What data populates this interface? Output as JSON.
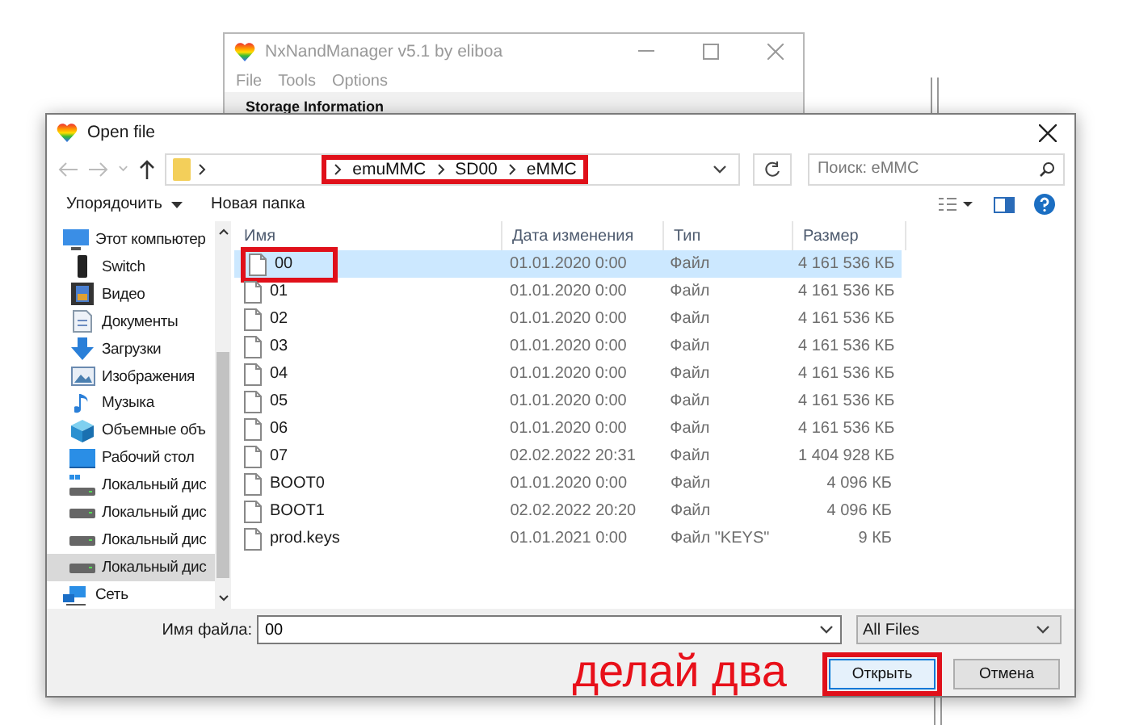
{
  "background_window": {
    "title": "NxNandManager v5.1 by eliboa",
    "menu": [
      "File",
      "Tools",
      "Options"
    ],
    "section_title": "Storage Information"
  },
  "dialog": {
    "title": "Open file",
    "address": {
      "crumbs": [
        "emuMMC",
        "SD00",
        "eMMC"
      ],
      "highlighted": true
    },
    "search": {
      "placeholder": "Поиск: eMMC"
    },
    "toolbar": {
      "organize": "Упорядочить",
      "new_folder": "Новая папка"
    },
    "nav": {
      "items": [
        {
          "label": "Этот компьютер",
          "kind": "computer",
          "selected": false,
          "child": false
        },
        {
          "label": "Switch",
          "kind": "device",
          "selected": false,
          "child": true
        },
        {
          "label": "Видео",
          "kind": "video",
          "selected": false,
          "child": true
        },
        {
          "label": "Документы",
          "kind": "documents",
          "selected": false,
          "child": true
        },
        {
          "label": "Загрузки",
          "kind": "downloads",
          "selected": false,
          "child": true
        },
        {
          "label": "Изображения",
          "kind": "pictures",
          "selected": false,
          "child": true
        },
        {
          "label": "Музыка",
          "kind": "music",
          "selected": false,
          "child": true
        },
        {
          "label": "Объемные объ",
          "kind": "objects",
          "selected": false,
          "child": true
        },
        {
          "label": "Рабочий стол",
          "kind": "desktop",
          "selected": false,
          "child": true
        },
        {
          "label": "Локальный дис",
          "kind": "system_disk",
          "selected": false,
          "child": true
        },
        {
          "label": "Локальный дис",
          "kind": "disk",
          "selected": false,
          "child": true
        },
        {
          "label": "Локальный дис",
          "kind": "disk",
          "selected": false,
          "child": true
        },
        {
          "label": "Локальный дис",
          "kind": "disk",
          "selected": true,
          "child": true
        }
      ],
      "network": "Сеть"
    },
    "table": {
      "columns": [
        "Имя",
        "Дата изменения",
        "Тип",
        "Размер"
      ],
      "rows": [
        {
          "name": "00",
          "date": "01.01.2020 0:00",
          "type": "Файл",
          "size": "4 161 536 КБ",
          "selected": true,
          "highlighted": true
        },
        {
          "name": "01",
          "date": "01.01.2020 0:00",
          "type": "Файл",
          "size": "4 161 536 КБ",
          "selected": false,
          "highlighted": false
        },
        {
          "name": "02",
          "date": "01.01.2020 0:00",
          "type": "Файл",
          "size": "4 161 536 КБ",
          "selected": false,
          "highlighted": false
        },
        {
          "name": "03",
          "date": "01.01.2020 0:00",
          "type": "Файл",
          "size": "4 161 536 КБ",
          "selected": false,
          "highlighted": false
        },
        {
          "name": "04",
          "date": "01.01.2020 0:00",
          "type": "Файл",
          "size": "4 161 536 КБ",
          "selected": false,
          "highlighted": false
        },
        {
          "name": "05",
          "date": "01.01.2020 0:00",
          "type": "Файл",
          "size": "4 161 536 КБ",
          "selected": false,
          "highlighted": false
        },
        {
          "name": "06",
          "date": "01.01.2020 0:00",
          "type": "Файл",
          "size": "4 161 536 КБ",
          "selected": false,
          "highlighted": false
        },
        {
          "name": "07",
          "date": "02.02.2022 20:31",
          "type": "Файл",
          "size": "1 404 928 КБ",
          "selected": false,
          "highlighted": false
        },
        {
          "name": "BOOT0",
          "date": "01.01.2020 0:00",
          "type": "Файл",
          "size": "4 096 КБ",
          "selected": false,
          "highlighted": false
        },
        {
          "name": "BOOT1",
          "date": "02.02.2022 20:20",
          "type": "Файл",
          "size": "4 096 КБ",
          "selected": false,
          "highlighted": false
        },
        {
          "name": "prod.keys",
          "date": "01.01.2021 0:00",
          "type": "Файл \"KEYS\"",
          "size": "9 КБ",
          "selected": false,
          "highlighted": false
        }
      ]
    },
    "filename": {
      "label": "Имя файла:",
      "value": "00"
    },
    "filter": {
      "value": "All Files"
    },
    "buttons": [
      {
        "label": "Открыть",
        "kind": "primary",
        "highlighted": true
      },
      {
        "label": "Отмена",
        "kind": "normal",
        "highlighted": false
      }
    ],
    "annotation": "делай два"
  }
}
